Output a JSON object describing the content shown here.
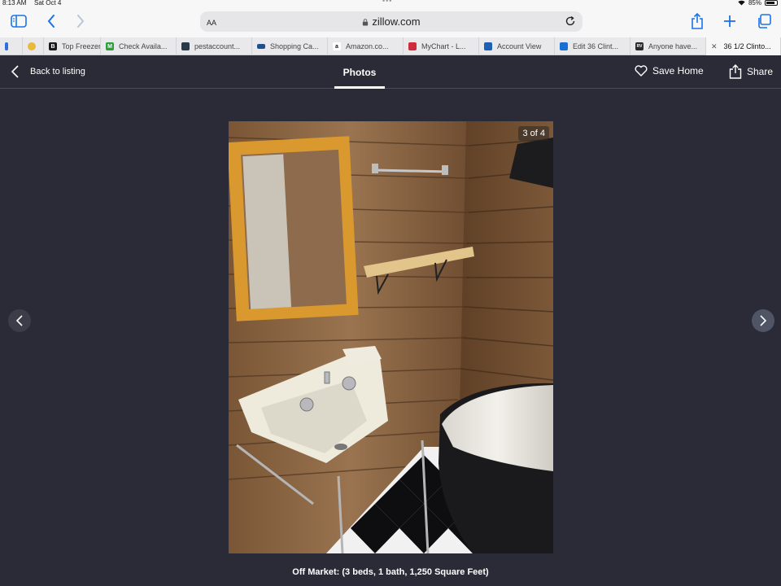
{
  "status": {
    "time": "8:13 AM",
    "date": "Sat Oct 4",
    "battery": "85%"
  },
  "browser": {
    "aa_label": "AA",
    "url": "zillow.com",
    "tabs": [
      {
        "label": "",
        "fav_color": "#2c6de0",
        "fav_text": ""
      },
      {
        "label": "",
        "fav_color": "#e8b93a",
        "fav_text": ""
      },
      {
        "label": "Top Freezer",
        "fav_color": "#1a1a1a",
        "fav_text": "B"
      },
      {
        "label": "Check Availa...",
        "fav_color": "#2e9e3e",
        "fav_text": "M"
      },
      {
        "label": "pestaccount...",
        "fav_color": "#2b3a4a",
        "fav_text": ""
      },
      {
        "label": "Shopping Ca...",
        "fav_color": "#1f4f8f",
        "fav_text": ""
      },
      {
        "label": "Amazon.co...",
        "fav_color": "#ffffff",
        "fav_text": "a"
      },
      {
        "label": "MyChart - L...",
        "fav_color": "#d02b3c",
        "fav_text": ""
      },
      {
        "label": "Account View",
        "fav_color": "#1c5fb3",
        "fav_text": ""
      },
      {
        "label": "Edit 36 Clint...",
        "fav_color": "#1a6fd6",
        "fav_text": ""
      },
      {
        "label": "Anyone have...",
        "fav_color": "#2a2a2a",
        "fav_text": "RV"
      },
      {
        "label": "36 1/2 Clinto...",
        "fav_color": "#e9e9ec",
        "fav_text": ""
      }
    ]
  },
  "header": {
    "back_label": "Back to listing",
    "title": "Photos",
    "save_label": "Save Home",
    "share_label": "Share"
  },
  "photo": {
    "counter": "3 of 4"
  },
  "caption": "Off Market: (3 beds, 1 bath, 1,250 Square Feet)"
}
